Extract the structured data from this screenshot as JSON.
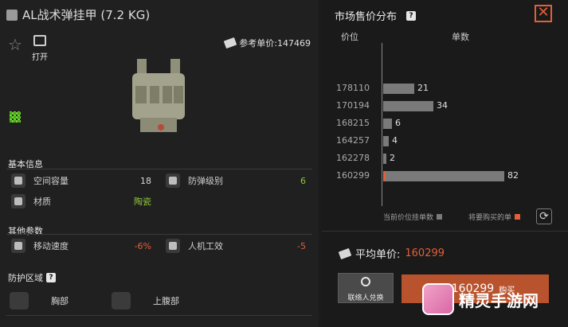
{
  "item": {
    "title": "AL战术弹挂甲 (7.2 KG)",
    "open_label": "打开",
    "ref_price_label": "参考单价:147469"
  },
  "basic": {
    "section_label": "基本信息",
    "capacity": {
      "name": "空间容量",
      "value": "18"
    },
    "armor_class": {
      "name": "防弹级别",
      "value": "6"
    },
    "material": {
      "name": "材质",
      "value": "陶瓷"
    }
  },
  "other": {
    "section_label": "其他参数",
    "move_speed": {
      "name": "移动速度",
      "value": "-6%"
    },
    "ergonomics": {
      "name": "人机工效",
      "value": "-5"
    }
  },
  "protection": {
    "section_label": "防护区域",
    "zones": [
      "胸部",
      "上腹部"
    ]
  },
  "market": {
    "title": "市场售价分布",
    "col_price": "价位",
    "col_qty": "单数",
    "legend_current": "当前价位挂单数",
    "legend_buy": "将要购买的单",
    "avg_label": "平均单价:",
    "avg_value": "160299",
    "exchange_label": "联络人兑换",
    "buy_amount": "160299",
    "buy_label": "购买"
  },
  "watermark": {
    "text": "精灵手游网"
  },
  "colors": {
    "accent": "#e0603a",
    "positive": "#8fc73c",
    "bar": "#7a7a7a"
  },
  "chart_data": {
    "type": "bar",
    "orientation": "horizontal",
    "categories": [
      "178110",
      "170194",
      "168215",
      "164257",
      "162278",
      "160299"
    ],
    "values": [
      21,
      34,
      6,
      4,
      2,
      82
    ],
    "xlabel": "单数",
    "ylabel": "价位",
    "grid": false
  }
}
